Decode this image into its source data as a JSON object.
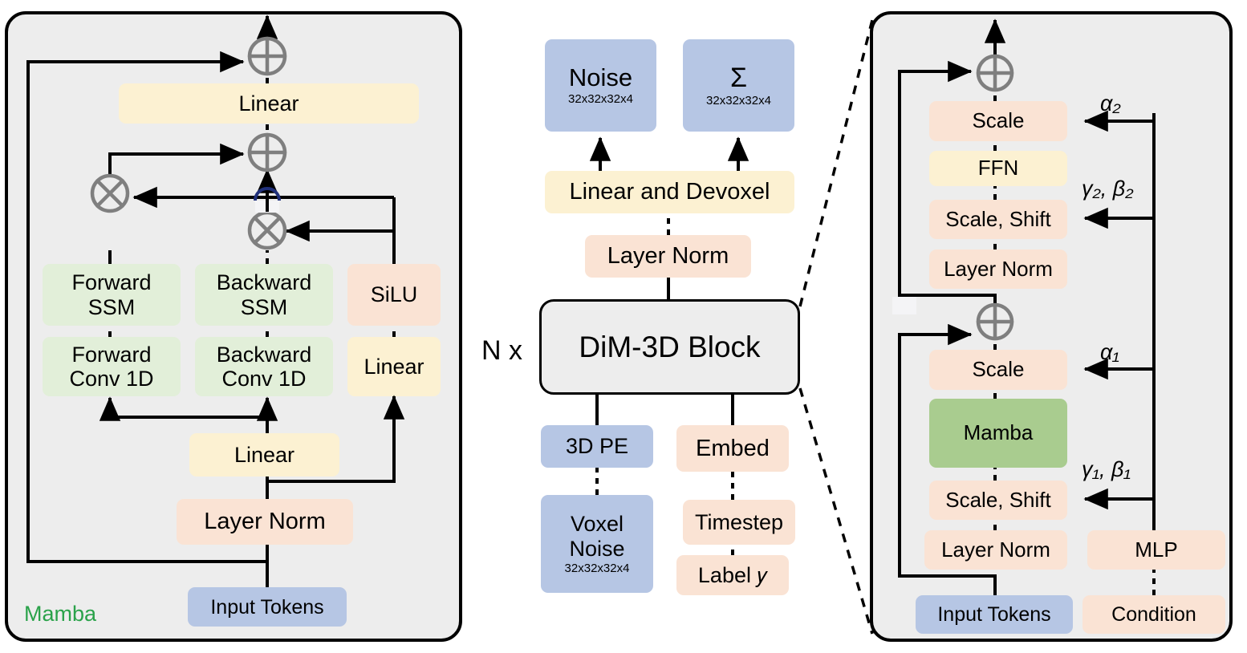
{
  "colors": {
    "yellow": "#fcf1d2",
    "green": "#e2efd9",
    "peach": "#fae3d4",
    "blue": "#b6c6e4",
    "mamba_green": "#a9cc8f",
    "panel_grey": "#ededed",
    "node_grey": "#7f7f7f",
    "mamba_label_green": "#2aa24a",
    "wire_black": "#000000"
  },
  "left_panel": {
    "name": "Mamba",
    "tag_label": "Mamba",
    "boxes": {
      "linear_top": "Linear",
      "forward_ssm": "Forward\nSSM",
      "forward_ssm_l1": "Forward",
      "forward_ssm_l2": "SSM",
      "backward_ssm_l1": "Backward",
      "backward_ssm_l2": "SSM",
      "silu": "SiLU",
      "forward_conv_l1": "Forward",
      "forward_conv_l2": "Conv 1D",
      "backward_conv_l1": "Backward",
      "backward_conv_l2": "Conv 1D",
      "linear_right": "Linear",
      "linear_mid": "Linear",
      "layer_norm": "Layer Norm",
      "input_tokens": "Input Tokens"
    },
    "operators": {
      "add_top": "+",
      "add_mid": "+",
      "mul_left": "x",
      "mul_right": "x"
    }
  },
  "middle_panel": {
    "noise": {
      "title": "Noise",
      "shape": "32x32x32x4"
    },
    "sigma": {
      "title": "Σ",
      "shape": "32x32x32x4"
    },
    "linear_devoxel": "Linear and Devoxel",
    "layer_norm": "Layer Norm",
    "repeat_label": "N x",
    "block_title": "DiM-3D Block",
    "pe_3d": "3D PE",
    "embed": "Embed",
    "voxel_noise": {
      "line1": "Voxel",
      "line2": "Noise",
      "shape": "32x32x32x4"
    },
    "timestep": "Timestep",
    "label_y": "Label 𝑦"
  },
  "right_panel": {
    "scale_2": "Scale",
    "ffn": "FFN",
    "scale_shift_2": "Scale, Shift",
    "layer_norm_2": "Layer Norm",
    "scale_1": "Scale",
    "mamba": "Mamba",
    "scale_shift_1": "Scale, Shift",
    "layer_norm_1": "Layer Norm",
    "mlp": "MLP",
    "input_tokens": "Input Tokens",
    "condition": "Condition",
    "alpha_2": "α₂",
    "gamma_beta_2": "γ₂, β₂",
    "alpha_1": "α₁",
    "gamma_beta_1": "γ₁, β₁",
    "operators": {
      "add_top": "+",
      "add_mid": "+"
    }
  }
}
